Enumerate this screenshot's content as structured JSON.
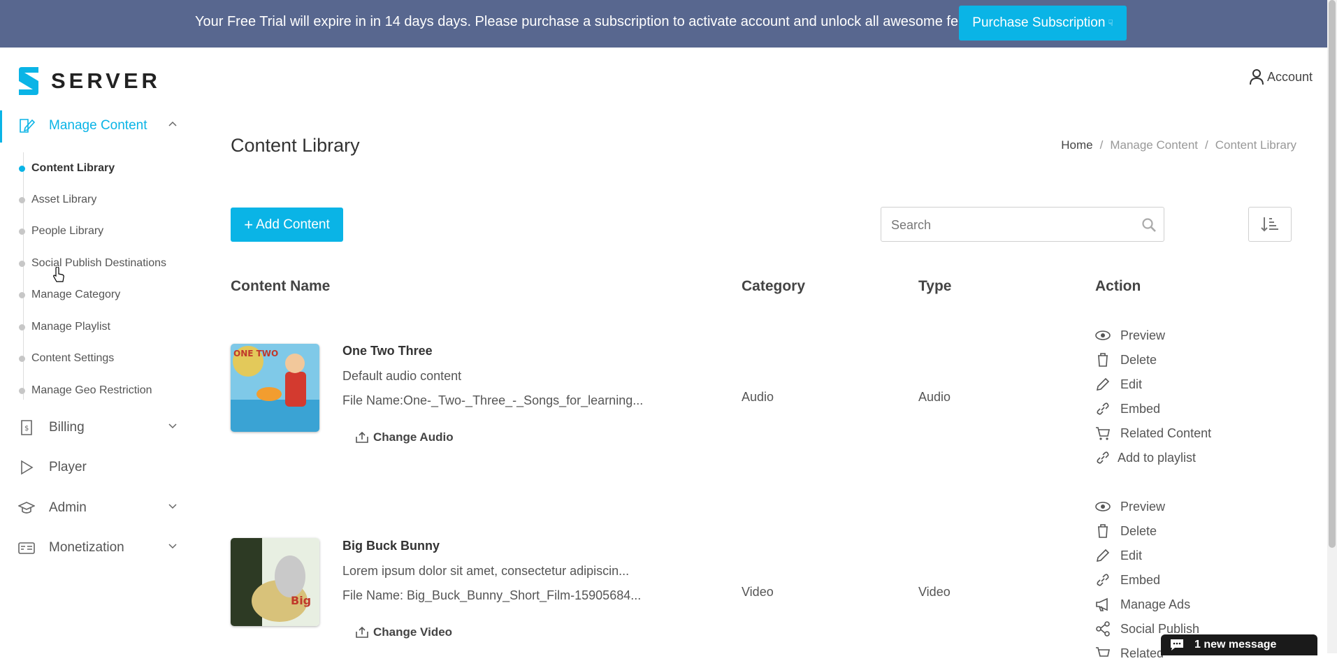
{
  "banner": {
    "text": "Your Free Trial will expire in in 14 days days. Please purchase a subscription to activate account and unlock all awesome features.",
    "button": "Purchase Subscription"
  },
  "logo": {
    "text": "SERVER"
  },
  "account": {
    "label": "Account"
  },
  "sidebar": {
    "items": [
      {
        "label": "Manage Content",
        "icon": "edit-document-icon",
        "expanded": true
      },
      {
        "label": "Billing",
        "icon": "invoice-icon"
      },
      {
        "label": "Player",
        "icon": "play-icon"
      },
      {
        "label": "Admin",
        "icon": "graduation-cap-icon"
      },
      {
        "label": "Monetization",
        "icon": "card-icon"
      }
    ],
    "sub_items": [
      "Content Library",
      "Asset Library",
      "People Library",
      "Social Publish Destinations",
      "Manage Category",
      "Manage Playlist",
      "Content Settings",
      "Manage Geo Restriction"
    ]
  },
  "page": {
    "title": "Content Library",
    "breadcrumb": [
      "Home",
      "Manage Content",
      "Content Library"
    ],
    "add_button": "Add Content",
    "search_placeholder": "Search"
  },
  "table": {
    "columns": [
      "Content Name",
      "Category",
      "Type",
      "Action"
    ],
    "rows": [
      {
        "name": "One Two Three",
        "description": "Default audio content",
        "file_name": "File Name:One-_Two-_Three_-_Songs_for_learning...",
        "change_label": "Change Audio",
        "category": "Audio",
        "type": "Audio",
        "actions": [
          "Preview",
          "Delete",
          "Edit",
          "Embed",
          "Related Content",
          "Add to playlist"
        ]
      },
      {
        "name": "Big Buck Bunny",
        "description": "Lorem ipsum dolor sit amet, consectetur adipiscin...",
        "file_name": "File Name: Big_Buck_Bunny_Short_Film-15905684...",
        "change_label": "Change Video",
        "category": "Video",
        "type": "Video",
        "actions": [
          "Preview",
          "Delete",
          "Edit",
          "Embed",
          "Manage Ads",
          "Social Publish",
          "Related"
        ]
      }
    ]
  },
  "chat": {
    "label": "1 new message"
  },
  "colors": {
    "banner": "#58678f",
    "accent": "#0ab4e6"
  }
}
